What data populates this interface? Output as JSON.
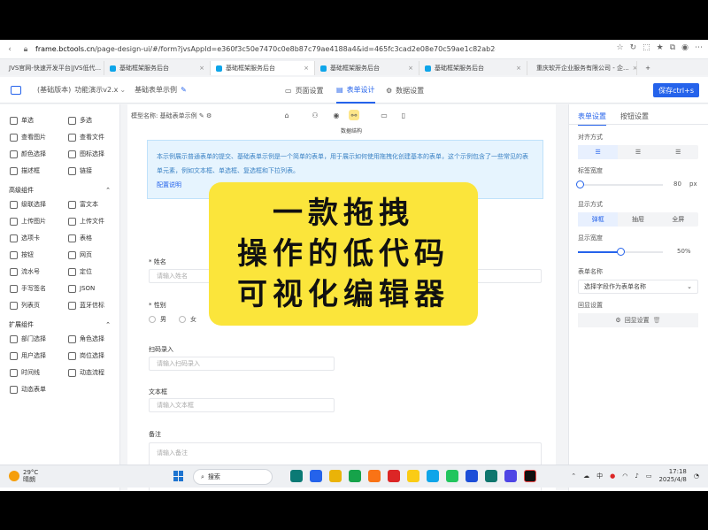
{
  "browser": {
    "url_host": "frame.bctools.cn",
    "url_path": "/page-design-ui/#/form?jvsAppId=e360f3c50e7470c0e8b87c79ae4188a4&id=465fc3cad2e08e70c59ae1c82ab2c3956b98&dataMo...",
    "tabs": [
      {
        "label": "JVS官网-快速开发平台|JVS低代...",
        "active": false
      },
      {
        "label": "基础框架服务后台",
        "active": false
      },
      {
        "label": "基础框架服务后台",
        "active": true
      },
      {
        "label": "基础框架服务后台",
        "active": false
      },
      {
        "label": "基础框架服务后台",
        "active": false
      },
      {
        "label": "重庆软开企业服务有限公司 - 企...",
        "active": false
      }
    ],
    "new_tab": "+"
  },
  "app": {
    "version": "(基础版本)",
    "demo": "功能演示v2.x",
    "form_name": "基础表单示例",
    "nav": [
      "页面设置",
      "表单设计",
      "数据设置"
    ],
    "active_nav": 1,
    "save_label": "保存ctrl+s"
  },
  "left_panel": {
    "basic_items": [
      "单选",
      "多选",
      "查看图片",
      "查看文件",
      "颜色选择",
      "图标选择",
      "描述框",
      "链接"
    ],
    "advanced_title": "高级组件",
    "advanced_items": [
      "级联选择",
      "富文本",
      "上传图片",
      "上传文件",
      "选项卡",
      "表格",
      "按钮",
      "网页",
      "流水号",
      "定位",
      "手写签名",
      "JSON",
      "列表页",
      "蓝牙信标"
    ],
    "extension_title": "扩展组件",
    "extension_items": [
      "部门选择",
      "角色选择",
      "用户选择",
      "岗位选择",
      "时间线",
      "动态流程",
      "动态表单"
    ]
  },
  "canvas": {
    "model_label": "模型名称:",
    "model_name": "基础表单示例",
    "tooltip": "数据结构",
    "notice_text_1": "本示例展示普通表单的提交、基础表单示例是一个简单的表单，用于展示如何使用拖拽化创建基本的表单，这个示例包含了一些常见的表",
    "notice_text_2": "单元素，例如文本框、单选框、复选框和下拉列表。",
    "notice_link": "配置说明",
    "fields": {
      "name_label": "* 姓名",
      "name_placeholder": "请输入姓名",
      "gender_label": "* 性别",
      "gender_options": [
        "男",
        "女"
      ],
      "scan_label": "扫码录入",
      "scan_placeholder": "请输入扫码录入",
      "textbox_label": "文本框",
      "textbox_placeholder": "请输入文本框",
      "remark_label": "备注",
      "remark_placeholder": "请输入备注"
    }
  },
  "right_panel": {
    "tabs": [
      "表单设置",
      "按钮设置"
    ],
    "align_label": "对齐方式",
    "label_width_label": "标签宽度",
    "label_width_value": "80",
    "label_width_unit": "px",
    "display_mode_label": "显示方式",
    "display_modes": [
      "弹框",
      "抽屉",
      "全屏"
    ],
    "display_mode_active": 0,
    "display_width_label": "显示宽度",
    "display_width_value": "50%",
    "display_width_fraction": 0.5,
    "form_name_label": "表单名称",
    "form_name_select": "选择字段作为表单名称",
    "callback_label": "回显设置",
    "callback_button": "回显设置"
  },
  "overlay": {
    "line1": "一款拖拽",
    "line2": "操作的低代码",
    "line3": "可视化编辑器"
  },
  "taskbar": {
    "temp": "29°C",
    "weather": "晴朗",
    "search_placeholder": "搜索",
    "ime": "中",
    "time": "17:18",
    "date": "2025/4/8"
  }
}
